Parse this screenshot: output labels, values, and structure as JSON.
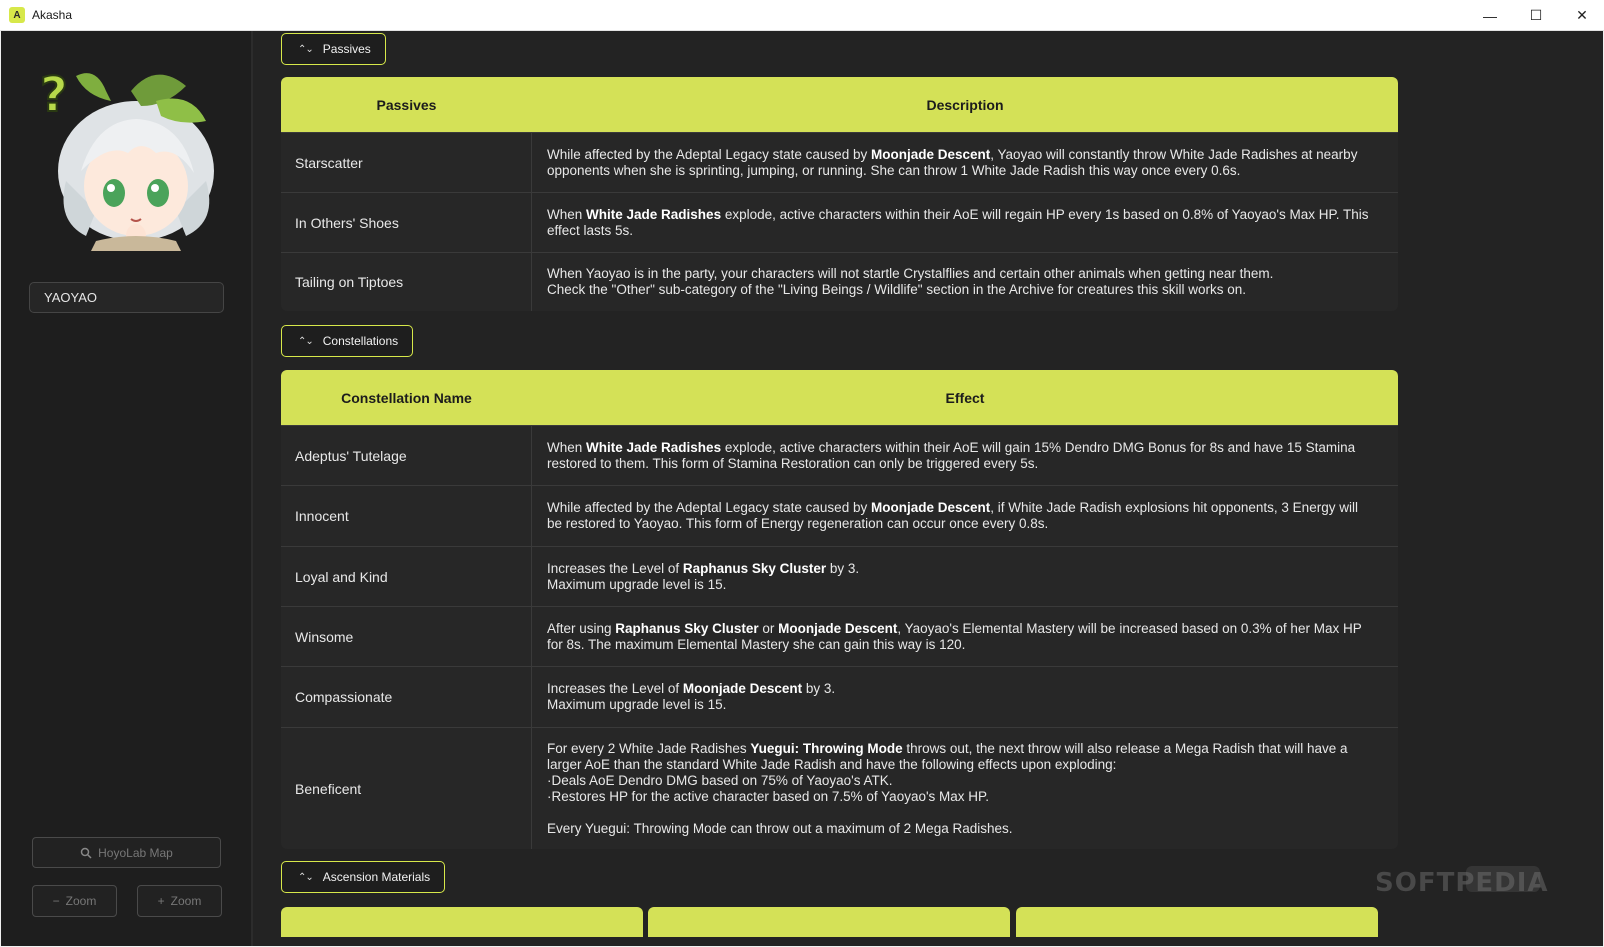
{
  "window": {
    "title": "Akasha",
    "icon_letters": "A",
    "minimize_glyph": "—",
    "maximize_glyph": "☐",
    "close_glyph": "✕"
  },
  "sidebar": {
    "character_name": "YAOYAO",
    "hoyolab_label": "HoyoLab Map",
    "hoyolab_icon": "search-icon",
    "zoom_out_label": "Zoom",
    "zoom_out_glyph": "−",
    "zoom_in_label": "Zoom",
    "zoom_in_glyph": "+"
  },
  "sections": {
    "passives_label": "Passives",
    "constellations_label": "Constellations",
    "ascension_label": "Ascension Materials"
  },
  "passives_table": {
    "headers": [
      "Passives",
      "Description"
    ],
    "rows": [
      {
        "name": "Starscatter",
        "parts": [
          "While affected by the Adeptal Legacy state caused by ",
          "Moonjade Descent",
          ", Yaoyao will constantly throw White Jade Radishes at nearby opponents when she is sprinting, jumping, or running. She can throw 1 White Jade Radish this way once every 0.6s."
        ]
      },
      {
        "name": "In Others' Shoes",
        "parts": [
          "When ",
          "White Jade Radishes",
          " explode, active characters within their AoE will regain HP every 1s based on 0.8% of Yaoyao's Max HP. This effect lasts 5s."
        ]
      },
      {
        "name": "Tailing on Tiptoes",
        "line1": "When Yaoyao is in the party, your characters will not startle Crystalflies and certain other animals when getting near them.",
        "line2": "Check the \"Other\" sub-category of the \"Living Beings / Wildlife\" section in the Archive for creatures this skill works on."
      }
    ]
  },
  "constellations_table": {
    "headers": [
      "Constellation Name",
      "Effect"
    ],
    "rows": [
      {
        "name": "Adeptus' Tutelage",
        "parts": [
          "When ",
          "White Jade Radishes",
          " explode, active characters within their AoE will gain 15% Dendro DMG Bonus for 8s and have 15 Stamina restored to them. This form of Stamina Restoration can only be triggered every 5s."
        ]
      },
      {
        "name": "Innocent",
        "parts": [
          "While affected by the Adeptal Legacy state caused by ",
          "Moonjade Descent",
          ", if White Jade Radish explosions hit opponents, 3 Energy will be restored to Yaoyao. This form of Energy regeneration can occur once every 0.8s."
        ]
      },
      {
        "name": "Loyal and Kind",
        "parts": [
          "Increases the Level of ",
          "Raphanus Sky Cluster",
          " by 3."
        ],
        "line2": "Maximum upgrade level is 15."
      },
      {
        "name": "Winsome",
        "parts": [
          "After using ",
          "Raphanus Sky Cluster",
          " or ",
          "Moonjade Descent",
          ", Yaoyao's Elemental Mastery will be increased based on 0.3% of her Max HP for 8s. The maximum Elemental Mastery she can gain this way is 120."
        ]
      },
      {
        "name": "Compassionate",
        "parts": [
          "Increases the Level of ",
          "Moonjade Descent",
          " by 3."
        ],
        "line2": "Maximum upgrade level is 15."
      },
      {
        "name": "Beneficent",
        "parts": [
          "For every 2 White Jade Radishes ",
          "Yuegui: Throwing Mode",
          " throws out, the next throw will also release a Mega Radish that will have a larger AoE than the standard White Jade Radish and have the following effects upon exploding:"
        ],
        "line2": "·Deals AoE Dendro DMG based on 75% of Yaoyao's ATK.",
        "line3": "·Restores HP for the active character based on 7.5% of Yaoyao's Max HP.",
        "line4": "Every Yuegui: Throwing Mode can throw out a maximum of 2 Mega Radishes."
      }
    ]
  },
  "watermark": "SOFTPEDIA",
  "colors": {
    "accent": "#d4e157",
    "background": "#232323",
    "sidebar": "#1e1e1e",
    "table_body": "#272727"
  }
}
